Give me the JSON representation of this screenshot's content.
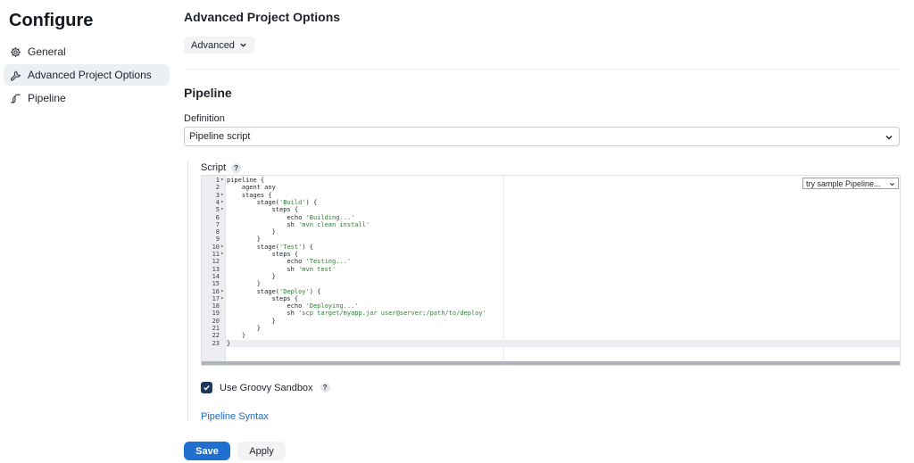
{
  "sidebar": {
    "title": "Configure",
    "items": [
      {
        "label": "General",
        "icon": "gear-icon"
      },
      {
        "label": "Advanced Project Options",
        "icon": "wrench-icon",
        "active": true
      },
      {
        "label": "Pipeline",
        "icon": "pipeline-icon"
      }
    ]
  },
  "main": {
    "advanced_title": "Advanced Project Options",
    "advanced_button": "Advanced",
    "pipeline_title": "Pipeline",
    "definition_label": "Definition",
    "definition_value": "Pipeline script",
    "script_label": "Script",
    "help_glyph": "?",
    "sample_select": "try sample Pipeline...",
    "code_lines": [
      "pipeline {",
      "    agent any",
      "    stages {",
      "        stage('Build') {",
      "            steps {",
      "                echo 'Building...'",
      "                sh 'mvn clean install'",
      "            }",
      "        }",
      "        stage('Test') {",
      "            steps {",
      "                echo 'Testing...'",
      "                sh 'mvn test'",
      "            }",
      "        }",
      "        stage('Deploy') {",
      "            steps {",
      "                echo 'Deploying...'",
      "                sh 'scp target/myapp.jar user@server:/path/to/deploy'",
      "            }",
      "        }",
      "    }",
      "}"
    ],
    "fold_lines": [
      1,
      3,
      4,
      5,
      10,
      11,
      16,
      17
    ],
    "active_line": 23,
    "sandbox_label": "Use Groovy Sandbox",
    "sandbox_checked": true,
    "syntax_link": "Pipeline Syntax",
    "save_label": "Save",
    "apply_label": "Apply"
  },
  "colors": {
    "accent": "#1f6fd1",
    "link": "#1968c6",
    "checkbox": "#1d3a5a",
    "active_nav": "#eceff3"
  }
}
